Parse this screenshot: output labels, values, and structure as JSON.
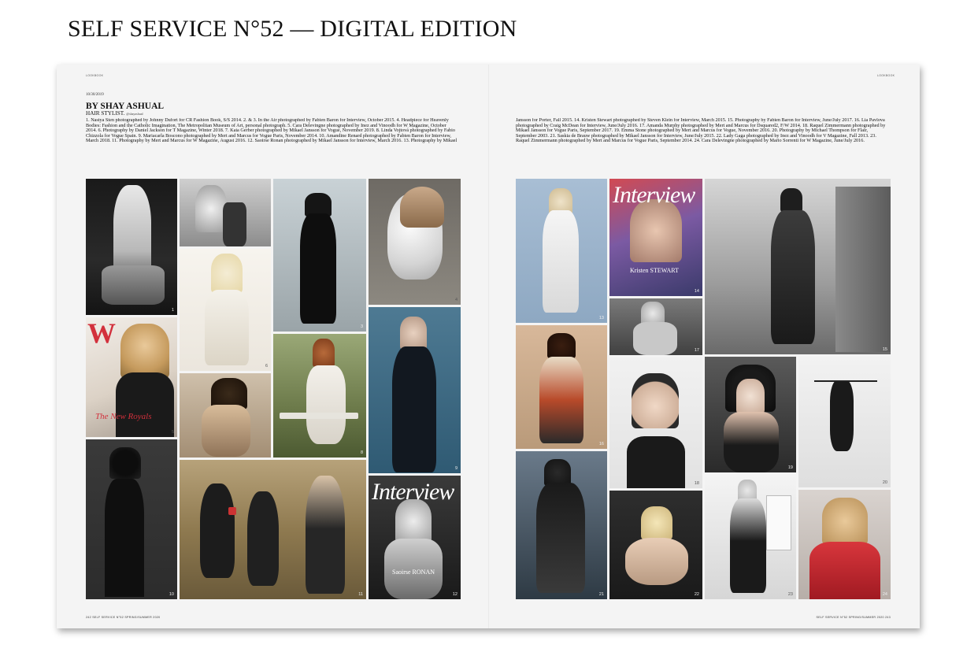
{
  "header": {
    "title": "SELF SERVICE N°52 — DIGITAL EDITION"
  },
  "left_page": {
    "running_head": "LOOKBOOK",
    "date": "10/30/2019",
    "byline": "BY SHAY ASHUAL",
    "role": "HAIR STYLIST.",
    "handle": "@shayashual",
    "credits": "1. Nastya Sten photographed by Johnny Dufort for CR Fashion Book, S/S 2014. 2. & 3. In the Air photographed by Fabien Baron for Interview, October 2015. 4. Headpiece for Heavenly Bodies: Fashion and the Catholic Imagination, The Metropolitan Museum of Art, personal photograph. 5. Cara Delevingne photographed by Inez and Vinoodh for W Magazine, October 2014. 6. Photography by Daniel Jackson for T Magazine, Winter 2018. 7. Kaia Gerber photographed by Mikael Jansson for Vogue, November 2019. 8. Linda Vojtová photographed by Fabio Chizzola for Vogue Spain. 9. Mariacarla Boscono photographed by Mert and Marcus for Vogue Paris, November 2014. 10. Amandine Renard photographed by Fabien Baron for Interview, March 2018. 11. Photography by Mert and Marcus for W Magazine, August 2016. 12. Saoirse Ronan photographed by Mikael Jansson for Interview, March 2016. 13. Photography by Mikael",
    "footer": "242  SELF SERVICE N°52 SPRING/SUMMER 2020",
    "tiles": [
      {
        "number": "1"
      },
      {
        "number": ""
      },
      {
        "number": "7"
      },
      {
        "number": "4"
      },
      {
        "number": "5"
      },
      {
        "number": "6"
      },
      {
        "number": "3"
      },
      {
        "number": "9"
      },
      {
        "number": ""
      },
      {
        "number": "8"
      },
      {
        "number": "10"
      },
      {
        "number": "11"
      },
      {
        "number": "12"
      }
    ],
    "cover_w": {
      "mast": "W",
      "headline": "The New Royals"
    },
    "cover_interview": {
      "mast": "Interview",
      "name": "Saoirse RONAN"
    }
  },
  "right_page": {
    "running_head": "LOOKBOOK",
    "credits": "Jansson for Porter, Fall 2015. 14. Kristen Stewart photographed by Steven Klein for Interview, March 2015. 15. Photography by Fabien Baron for Interview, June/July 2017. 16. Lia Pavlova photographed by Craig McDean for Interview, June/July 2016. 17. Amanda Murphy photographed by Mert and Marcus for Dsquared2, F/W 2014. 18. Raquel Zimmermann photographed by Mikael Jansson for Vogue Paris, September 2017. 19. Emma Stone photographed by Mert and Marcus for Vogue, November 2016. 20. Photography by Michael Thompson for Flair, September 2003. 21. Saskia de Brauw photographed by Mikael Jansson for Interview, June/July 2015. 22. Lady Gaga photographed by Inez and Vinoodh for V Magazine, Fall 2013. 23. Raquel Zimmermann photographed by Mert and Marcus for Vogue Paris, September 2014. 24. Cara Delevingne photographed by Mario Sorrenti for W Magazine, June/July 2016.",
    "footer": "SELF SERVICE N°52 SPRING/SUMMER 2020  243",
    "tiles": [
      {
        "number": "13"
      },
      {
        "number": "14"
      },
      {
        "number": "15"
      },
      {
        "number": "17"
      },
      {
        "number": "16"
      },
      {
        "number": "18"
      },
      {
        "number": "19"
      },
      {
        "number": "20"
      },
      {
        "number": "21"
      },
      {
        "number": "22"
      },
      {
        "number": "23"
      },
      {
        "number": "24"
      }
    ],
    "cover_interview": {
      "mast": "Interview",
      "name": "Kristen STEWART"
    }
  },
  "colors": {
    "cover_red": "#d2303c",
    "paper": "#f4f4f4"
  }
}
